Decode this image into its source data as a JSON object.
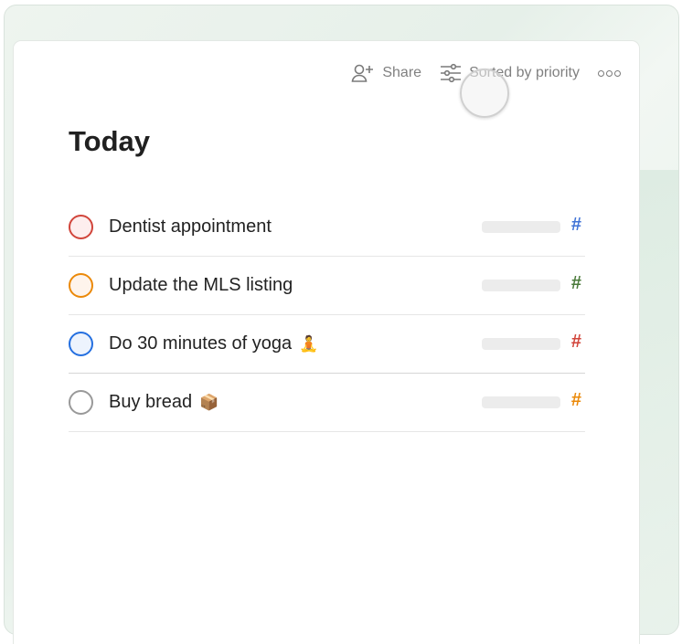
{
  "toolbar": {
    "share_label": "Share",
    "sort_label": "Sorted by priority",
    "share_icon": "person-add-icon",
    "sort_icon": "sliders-icon",
    "more_icon": "more-horizontal-icon"
  },
  "page": {
    "title": "Today"
  },
  "tasks": [
    {
      "title": "Dentist appointment",
      "emoji": "",
      "check_color": "#d1453b",
      "check_fill": "#fdeeee",
      "hash": "#",
      "hash_color": "#4073d6"
    },
    {
      "title": "Update the MLS listing",
      "emoji": "",
      "check_color": "#eb8909",
      "check_fill": "#fef4ec",
      "hash": "#",
      "hash_color": "#4a7a3a"
    },
    {
      "title": "Do 30 minutes of yoga",
      "emoji": "🧘",
      "check_color": "#246fe0",
      "check_fill": "#edf3fd",
      "hash": "#",
      "hash_color": "#d1453b"
    },
    {
      "title": "Buy bread",
      "emoji": "📦",
      "check_color": "#999999",
      "check_fill": "#ffffff",
      "hash": "#",
      "hash_color": "#eb8909"
    }
  ]
}
